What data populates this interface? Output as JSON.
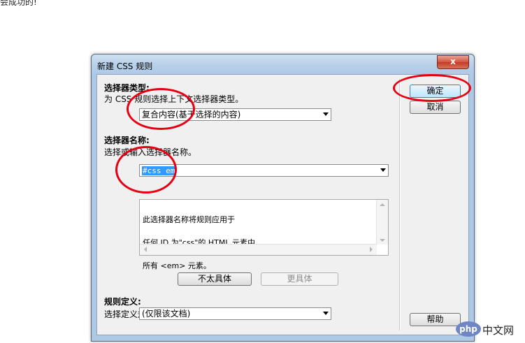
{
  "page": {
    "top_text": "会成功的!"
  },
  "dialog": {
    "title": "新建 CSS 规则",
    "close_label": "x",
    "selector_type": {
      "heading": "选择器类型:",
      "description": "为 CSS 规则选择上下文选择器类型。",
      "selected": "复合内容(基于选择的内容)"
    },
    "selector_name": {
      "heading": "选择器名称:",
      "description": "选择或输入选择器名称。",
      "value": "#css em",
      "info_lines": [
        "此选择器名称将规则应用于",
        "任何 ID 为\"css\"的 HTML 元素中",
        "所有 <em> 元素。"
      ],
      "less_specific_label": "不太具体",
      "more_specific_label": "更具体"
    },
    "rule_definition": {
      "heading": "规则定义:",
      "description": "选择定义规则的位置。",
      "selected": "(仅限该文档)"
    },
    "ok_label": "确定",
    "cancel_label": "取消",
    "help_label": "帮助"
  },
  "annotation_color": "#e60012",
  "watermark": {
    "logo_text": "php",
    "site_text": "中文网"
  }
}
